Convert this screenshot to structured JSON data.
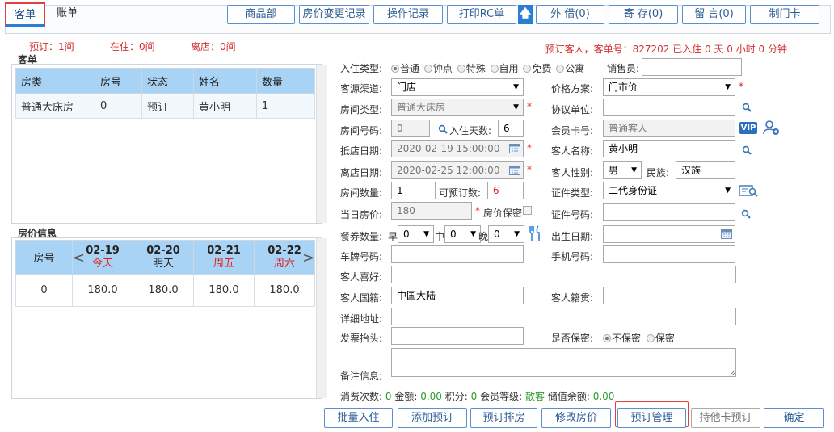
{
  "tabs": {
    "guest": "客单",
    "bill": "账单"
  },
  "toolbar": {
    "items": "商品部",
    "price_log": "房价变更记录",
    "op_log": "操作记录",
    "print_rc": "打印RC单",
    "borrow": "外 借(0)",
    "deposit": "寄 存(0)",
    "message": "留 言(0)",
    "make_card": "制门卡"
  },
  "status": {
    "booked": "预订：1间",
    "in_house": "在住：0间",
    "departed": "离店：0间",
    "right": "预订客人，客单号：827202 已入住 0 天 0 小时 0 分钟"
  },
  "guest_panel": {
    "title": "客单",
    "headers": [
      "房类",
      "房号",
      "状态",
      "姓名",
      "数量"
    ],
    "rows": [
      [
        "普通大床房",
        "0",
        "预订",
        "黄小明",
        "1"
      ]
    ]
  },
  "price_panel": {
    "title": "房价信息",
    "room_header": "房号",
    "dates": [
      {
        "date": "02-19",
        "day": "今天"
      },
      {
        "date": "02-20",
        "day": "明天"
      },
      {
        "date": "02-21",
        "day": "周五"
      },
      {
        "date": "02-22",
        "day": "周六"
      }
    ],
    "row": {
      "room": "0",
      "prices": [
        "180.0",
        "180.0",
        "180.0",
        "180.0"
      ]
    }
  },
  "form": {
    "checkin_type_label": "入住类型:",
    "checkin_types": [
      "普通",
      "钟点",
      "特殊",
      "自用",
      "免费",
      "公寓"
    ],
    "salesperson_label": "销售员:",
    "source_label": "客源渠道:",
    "source_value": "门店",
    "price_plan_label": "价格方案:",
    "price_plan_value": "门市价",
    "room_type_label": "房间类型:",
    "room_type_value": "普通大床房",
    "agreement_label": "协议单位:",
    "room_no_label": "房间号码:",
    "room_no_value": "0",
    "stay_days_label": "入住天数:",
    "stay_days_value": "6",
    "member_card_label": "会员卡号:",
    "member_card_placeholder": "普通客人",
    "arrival_label": "抵店日期:",
    "arrival_value": "2020-02-19 15:00:00",
    "guest_name_label": "客人名称:",
    "guest_name_value": "黄小明",
    "departure_label": "离店日期:",
    "departure_value": "2020-02-25 12:00:00",
    "gender_label": "客人性别:",
    "gender_value": "男",
    "ethnic_label": "民族:",
    "ethnic_value": "汉族",
    "room_count_label": "房间数量:",
    "room_count_value": "1",
    "bookable_label": "可预订数:",
    "bookable_value": "6",
    "id_type_label": "证件类型:",
    "id_type_value": "二代身份证",
    "rate_label": "当日房价:",
    "rate_value": "180",
    "rate_secret_label": "房价保密",
    "id_no_label": "证件号码:",
    "breakfast_label": "餐券数量:",
    "breakfast_early": "早",
    "breakfast_mid": "中",
    "breakfast_late": "晚",
    "breakfast_value": "0",
    "birthday_label": "出生日期:",
    "plate_label": "车牌号码:",
    "phone_label": "手机号码:",
    "hobby_label": "客人喜好:",
    "nationality_label": "客人国籍:",
    "nationality_value": "中国大陆",
    "native_label": "客人籍贯:",
    "address_label": "详细地址:",
    "invoice_label": "发票抬头:",
    "secret_label": "是否保密:",
    "secret_options": [
      "不保密",
      "保密"
    ],
    "remark_label": "备注信息:",
    "vip_badge": "VIP"
  },
  "stats": {
    "count_label": "消费次数:",
    "count": "0",
    "amount_label": "金额:",
    "amount": "0.00",
    "points_label": "积分:",
    "points": "0",
    "level_label": "会员等级:",
    "level": "散客",
    "balance_label": "储值余额:",
    "balance": "0.00"
  },
  "buttons": {
    "batch_checkin": "批量入住",
    "add_booking": "添加预订",
    "booking_rooms": "预订排房",
    "modify_rate": "修改房价",
    "booking_manage": "预订管理",
    "other_card": "持他卡预订",
    "confirm": "确定"
  },
  "colors": {
    "accent": "#2a7fd4",
    "header_blue": "#a9d3f4",
    "warning": "#e02020"
  }
}
